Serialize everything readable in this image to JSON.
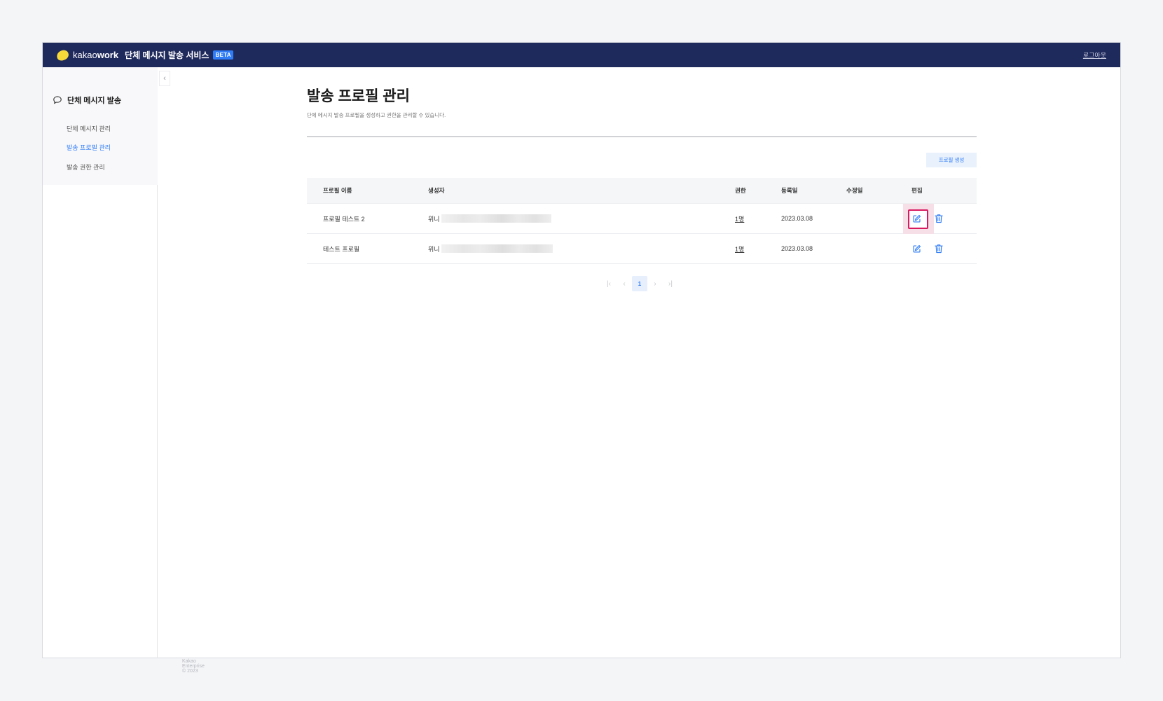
{
  "header": {
    "logo_text_light": "kakao",
    "logo_text_bold": "work",
    "service_title": "단체 메시지 발송 서비스",
    "beta_badge": "BETA",
    "logout": "로그아웃"
  },
  "sidebar": {
    "group_label": "단체 메시지 발송",
    "items": [
      {
        "label": "단체 메시지 관리",
        "active": false
      },
      {
        "label": "발송 프로필 관리",
        "active": true
      },
      {
        "label": "발송 권한 관리",
        "active": false
      }
    ],
    "collapse_icon": "chevron-left-icon",
    "footer": "Kakao Enterprise © 2023"
  },
  "main": {
    "title": "발송 프로필 관리",
    "description": "단체 메시지 발송 프로필을 생성하고 권한을 관리할 수 있습니다.",
    "create_button": "프로필 생성",
    "table": {
      "headers": {
        "name": "프로필 이름",
        "creator": "생성자",
        "permission": "권한",
        "registered": "등록일",
        "modified": "수정일",
        "edit": "편집"
      },
      "rows": [
        {
          "name": "프로필 테스트 2",
          "creator": "위니",
          "permission": "1명",
          "registered": "2023.03.08",
          "modified": ""
        },
        {
          "name": "테스트 프로필",
          "creator": "위니",
          "permission": "1명",
          "registered": "2023.03.08",
          "modified": ""
        }
      ]
    },
    "pagination": {
      "current_page": "1",
      "first": "|‹",
      "prev": "‹",
      "next": "›",
      "last": "›|"
    }
  },
  "colors": {
    "topbar": "#1f2a5c",
    "accent": "#2f7cf6",
    "highlight": "#d81b60"
  }
}
